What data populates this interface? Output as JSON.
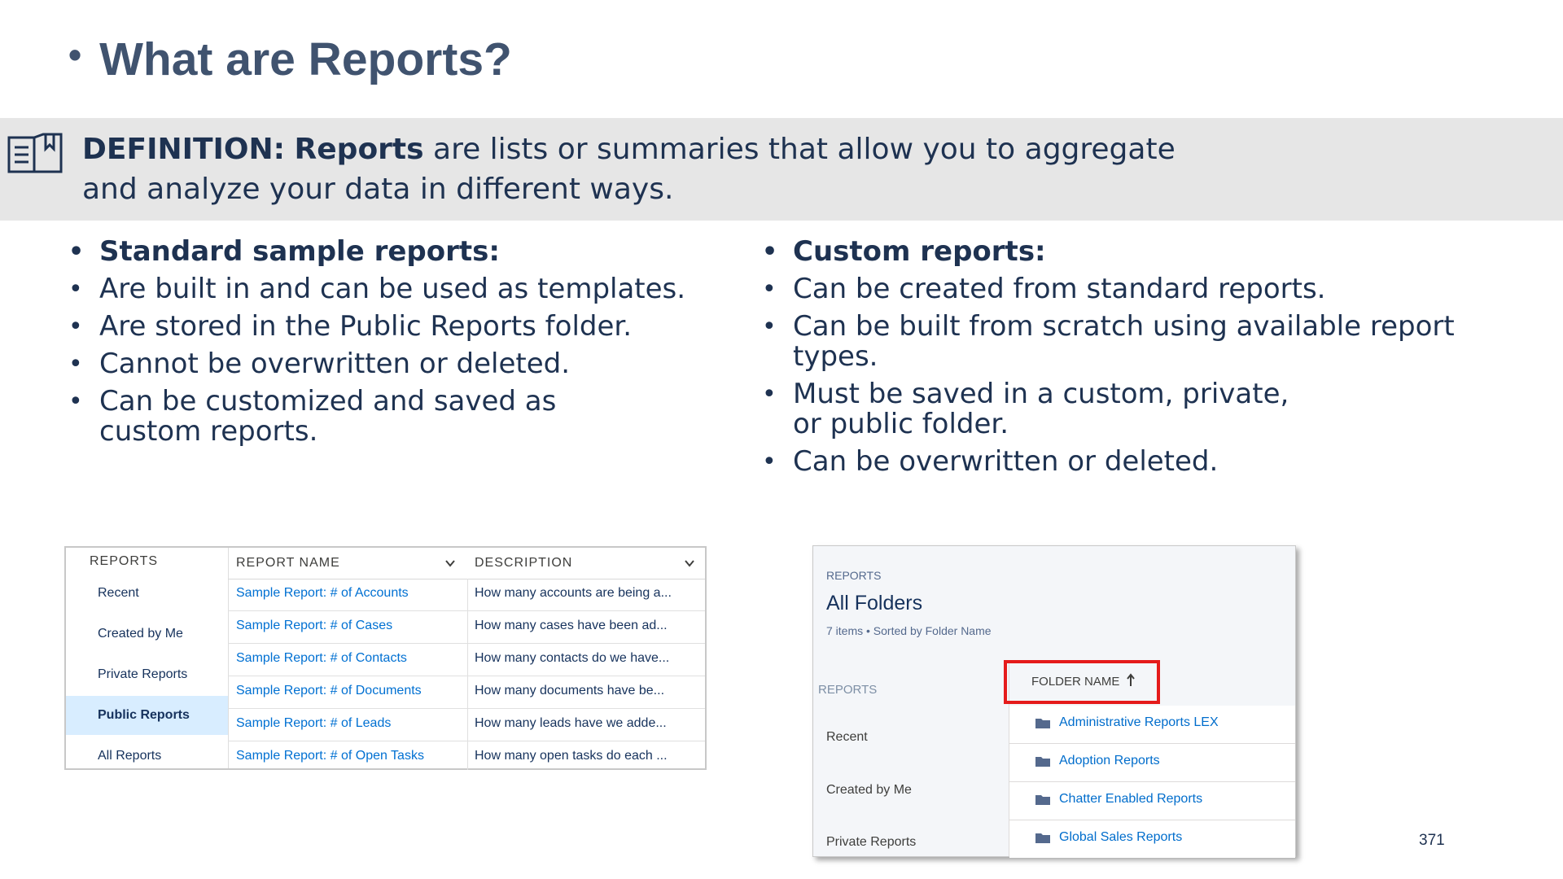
{
  "slide": {
    "title": "What are Reports?",
    "definition": {
      "label": "DEFINITION:",
      "term": "Reports",
      "text": " are lists or summaries that allow you to aggregate and analyze your data in different ways."
    },
    "left_list": [
      "Standard sample reports:",
      "Are built in and can be used as templates.",
      "Are stored in the Public Reports folder.",
      "Cannot be overwritten or deleted.",
      "Can be customized and saved as custom reports."
    ],
    "right_list": [
      "Custom reports:",
      "Can be created from standard reports.",
      "Can be built from scratch using available report types.",
      "Must be saved in a custom, private, or public folder.",
      "Can be overwritten or deleted."
    ],
    "page_number": "371"
  },
  "screenshot1": {
    "sidebar_header": "REPORTS",
    "sidebar_items": [
      "Recent",
      "Created by Me",
      "Private Reports",
      "Public Reports",
      "All Reports"
    ],
    "active_item": "Public Reports",
    "columns": [
      "REPORT NAME",
      "DESCRIPTION"
    ],
    "rows": [
      {
        "name": "Sample Report: # of Accounts",
        "description": "How many accounts are being a..."
      },
      {
        "name": "Sample Report: # of Cases",
        "description": "How many cases have been ad..."
      },
      {
        "name": "Sample Report: # of Contacts",
        "description": "How many contacts do we have..."
      },
      {
        "name": "Sample Report: # of Documents",
        "description": "How many documents have be..."
      },
      {
        "name": "Sample Report: # of Leads",
        "description": "How many leads have we adde..."
      },
      {
        "name": "Sample Report: # of Open Tasks",
        "description": "How many open tasks do each ..."
      }
    ]
  },
  "screenshot2": {
    "header_label": "REPORTS",
    "header_title": "All Folders",
    "header_subtitle": "7 items • Sorted by Folder Name",
    "sidebar_header": "REPORTS",
    "sidebar_items": [
      "Recent",
      "Created by Me",
      "Private Reports"
    ],
    "column_header": "FOLDER NAME",
    "folders": [
      "Administrative Reports LEX",
      "Adoption Reports",
      "Chatter Enabled Reports",
      "Global Sales Reports"
    ],
    "highlight_color": "#e51b1b"
  }
}
